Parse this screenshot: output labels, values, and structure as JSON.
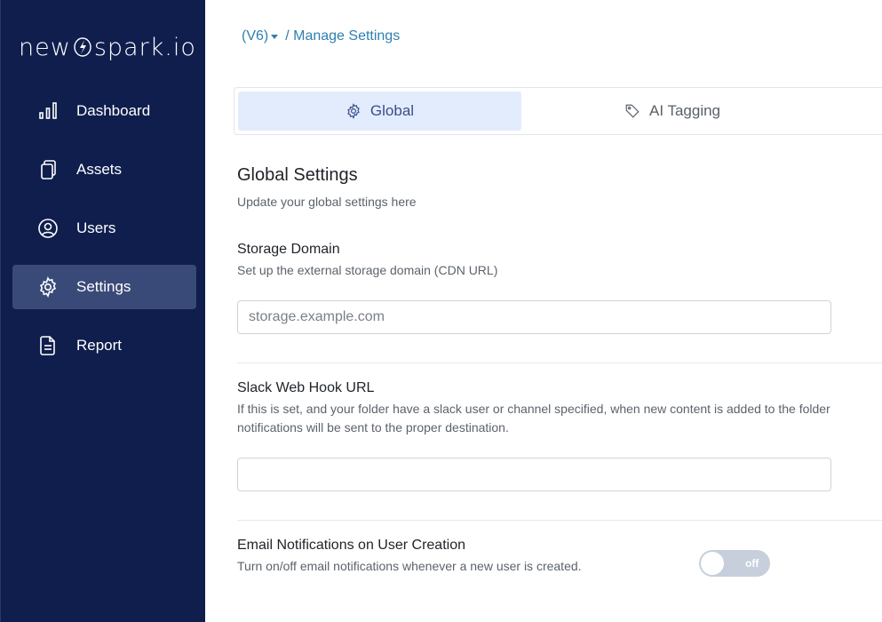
{
  "brand": {
    "logo_left": "new",
    "logo_right": "spark.io"
  },
  "sidebar": {
    "items": [
      {
        "label": "Dashboard",
        "icon": "bar-chart-icon"
      },
      {
        "label": "Assets",
        "icon": "copy-icon"
      },
      {
        "label": "Users",
        "icon": "user-circle-icon"
      },
      {
        "label": "Settings",
        "icon": "gear-icon",
        "active": true
      },
      {
        "label": "Report",
        "icon": "document-icon"
      }
    ]
  },
  "breadcrumb": {
    "version": "(V6)",
    "page": "/ Manage Settings"
  },
  "tabs": [
    {
      "label": "Global",
      "icon": "gear-icon",
      "active": true
    },
    {
      "label": "AI Tagging",
      "icon": "tag-icon"
    }
  ],
  "section": {
    "title": "Global Settings",
    "subtitle": "Update your global settings here"
  },
  "storage": {
    "label": "Storage Domain",
    "description": "Set up the external storage domain (CDN URL)",
    "placeholder": "storage.example.com",
    "value": ""
  },
  "slack": {
    "label": "Slack Web Hook URL",
    "description": "If this is set, and your folder have a slack user or channel specified, when new content is added to the folder notifications will be sent to the proper destination.",
    "value": ""
  },
  "email_notifications": {
    "label": "Email Notifications on User Creation",
    "description": "Turn on/off email notifications whenever a new user is created.",
    "toggle_text": "off",
    "enabled": false
  },
  "colors": {
    "sidebar_bg": "#0f1e4d",
    "active_item": "#3a4a78",
    "accent": "#2f7fb0",
    "tab_active_bg": "#e3ecfc"
  }
}
